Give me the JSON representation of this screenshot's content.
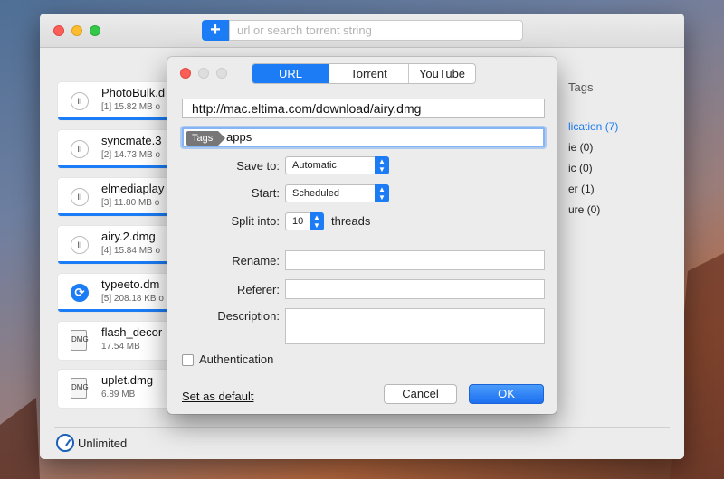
{
  "toolbar": {
    "add_icon": "plus-icon",
    "add_label": "+",
    "url_placeholder": "url or search torrent string"
  },
  "downloads": [
    {
      "name": "PhotoBulk.d",
      "size": "[1] 15.82 MB o",
      "progress": 1.0,
      "state": "pause-icon",
      "icon_label": "II"
    },
    {
      "name": "syncmate.3",
      "size": "[2] 14.73 MB o",
      "progress": 1.0,
      "state": "pause-icon",
      "icon_label": "II"
    },
    {
      "name": "elmediaplay",
      "size": "[3] 11.80 MB o",
      "progress": 1.0,
      "state": "pause-icon",
      "icon_label": "II"
    },
    {
      "name": "airy.2.dmg",
      "size": "[4] 15.84 MB o",
      "progress": 1.0,
      "state": "pause-icon",
      "icon_label": "II"
    },
    {
      "name": "typeeto.dm",
      "size": "[5] 208.18 KB o",
      "progress": 1.0,
      "state": "refresh-icon",
      "icon_label": "⟳"
    },
    {
      "name": "flash_decor",
      "size": "17.54 MB",
      "progress": 0,
      "state": "file-icon",
      "icon_label": "DMG"
    },
    {
      "name": "uplet.dmg",
      "size": "6.89 MB",
      "progress": 0,
      "state": "file-icon",
      "icon_label": "DMG"
    }
  ],
  "tags_panel": {
    "header": "Tags",
    "items": [
      {
        "label": "lication (7)",
        "selected": true
      },
      {
        "label": "ie (0)",
        "selected": false
      },
      {
        "label": "ic (0)",
        "selected": false
      },
      {
        "label": "er (1)",
        "selected": false
      },
      {
        "label": "ure (0)",
        "selected": false
      }
    ]
  },
  "status": {
    "speed_label": "Unlimited",
    "speed_icon": "speedometer-icon"
  },
  "dialog": {
    "tabs": [
      "URL",
      "Torrent",
      "YouTube"
    ],
    "active_tab": "URL",
    "url_value": "http://mac.eltima.com/download/airy.dmg",
    "tags_chip": "Tags",
    "tags_value": "apps",
    "save_to_label": "Save to:",
    "save_to_value": "Automatic",
    "start_label": "Start:",
    "start_value": "Scheduled",
    "split_label": "Split into:",
    "split_value": "10",
    "split_suffix": "threads",
    "rename_label": "Rename:",
    "referer_label": "Referer:",
    "description_label": "Description:",
    "auth_label": "Authentication",
    "set_default": "Set as default",
    "cancel": "Cancel",
    "ok": "OK"
  }
}
